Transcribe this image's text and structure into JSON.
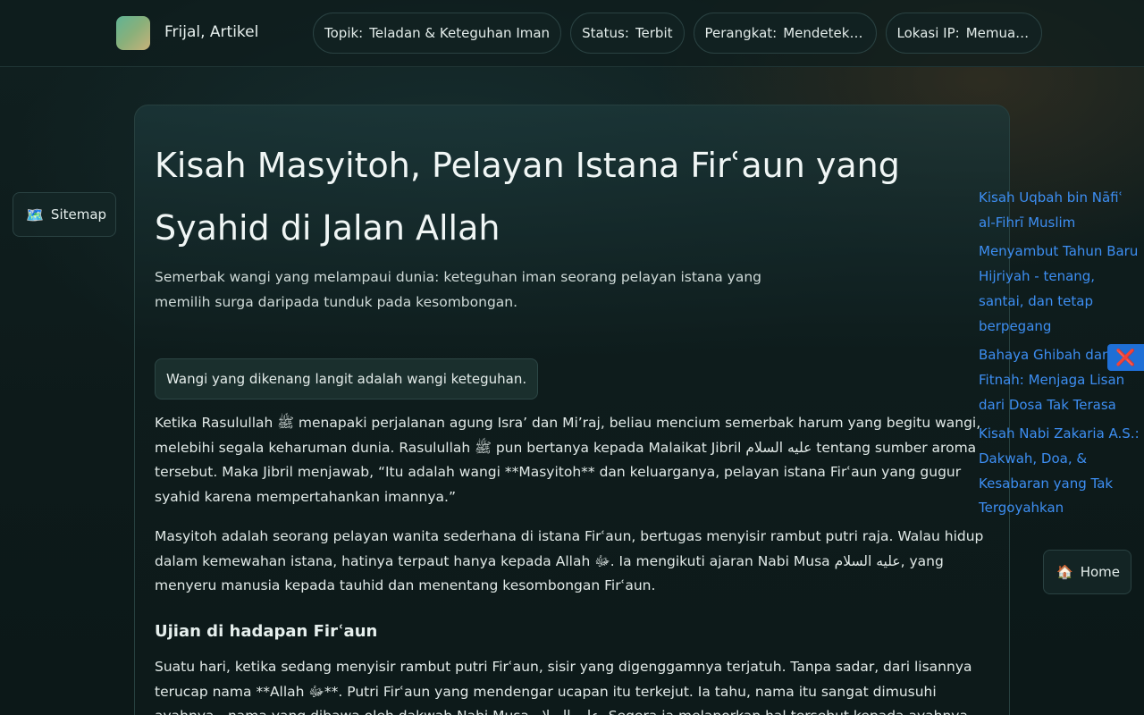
{
  "header": {
    "brand": "Frijal, Artikel",
    "chips": [
      {
        "key": "Topik:",
        "value": "Teladan & Keteguhan Iman"
      },
      {
        "key": "Status:",
        "value": "Terbit"
      },
      {
        "key": "Perangkat:",
        "value": "Mendeteksi…"
      },
      {
        "key": "Lokasi IP:",
        "value": "Memuat…"
      }
    ]
  },
  "sitemap": {
    "icon": "🗺️",
    "label": "Sitemap"
  },
  "article": {
    "title": "Kisah Masyitoh, Pelayan Istana Firʿaun yang Syahid di Jalan Allah",
    "subtitle": "Semerbak wangi yang melampaui dunia: keteguhan iman seorang pelayan istana yang memilih surga daripada tunduk pada kesombongan.",
    "quote": "Wangi yang dikenang langit adalah wangi keteguhan.",
    "paragraphs": [
      "Ketika Rasulullah ﷺ menapaki perjalanan agung Isra’ dan Mi’raj, beliau mencium semerbak harum yang begitu wangi, melebihi segala keharuman dunia. Rasulullah ﷺ pun bertanya kepada Malaikat Jibril عليه السلام tentang sumber aroma tersebut. Maka Jibril menjawab, “Itu adalah wangi **Masyitoh** dan keluarganya, pelayan istana Firʿaun yang gugur syahid karena mempertahankan imannya.”",
      "Masyitoh adalah seorang pelayan wanita sederhana di istana Firʿaun, bertugas menyisir rambut putri raja. Walau hidup dalam kemewahan istana, hatinya terpaut hanya kepada Allah ﷻ. Ia mengikuti ajaran Nabi Musa عليه السلام, yang menyeru manusia kepada tauhid dan menentang kesombongan Firʿaun."
    ],
    "section_heading": "Ujian di hadapan Firʿaun",
    "section_paragraph": "Suatu hari, ketika sedang menyisir rambut putri Firʿaun, sisir yang digenggamnya terjatuh. Tanpa sadar, dari lisannya terucap nama **Allah ﷻ**. Putri Firʿaun yang mendengar ucapan itu terkejut. Ia tahu, nama itu sangat dimusuhi ayahnya—nama yang dibawa oleh dakwah Nabi Musa عليه السلام. Segera ia melaporkan hal tersebut kepada ayahnya."
  },
  "related_links": [
    "Kisah Uqbah bin Nāfiʿ al-Fihrī Muslim",
    "Menyambut Tahun Baru Hijriyah - tenang, santai, dan tetap berpegang",
    "Bahaya Ghibah dan Fitnah: Menjaga Lisan dari Dosa Tak Terasa",
    "Kisah Nabi Zakaria A.S.: Dakwah, Doa, & Kesabaran yang Tak Tergoyahkan"
  ],
  "close_button": {
    "icon": "❌"
  },
  "home": {
    "icon": "🏠",
    "label": "Home"
  }
}
